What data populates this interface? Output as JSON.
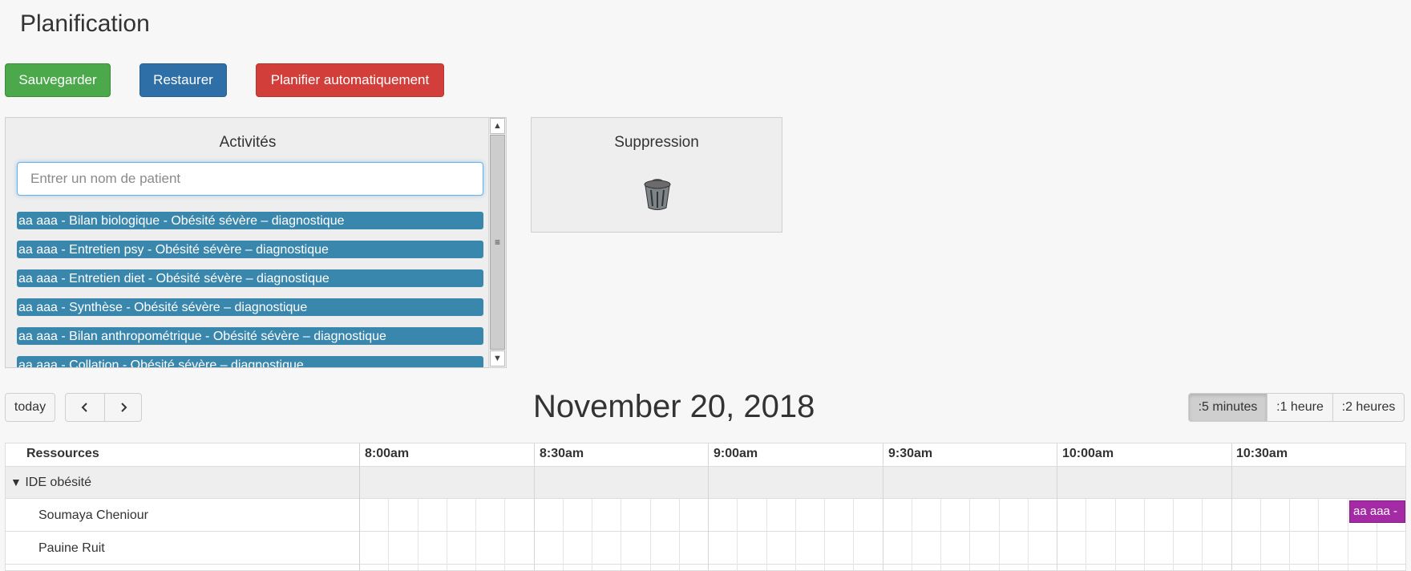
{
  "header": {
    "title": "Planification"
  },
  "toolbar": {
    "save_label": "Sauvegarder",
    "restore_label": "Restaurer",
    "auto_label": "Planifier automatiquement"
  },
  "activities": {
    "title": "Activités",
    "search_placeholder": "Entrer un nom de patient",
    "items": [
      "aa aaa - Bilan biologique - Obésité sévère – diagnostique",
      "aa aaa - Entretien psy - Obésité sévère – diagnostique",
      "aa aaa - Entretien diet - Obésité sévère – diagnostique",
      "aa aaa - Synthèse - Obésité sévère – diagnostique",
      "aa aaa - Bilan anthropométrique - Obésité sévère – diagnostique",
      "aa aaa - Collation - Obésité sévère – diagnostique"
    ],
    "item_color": "#3a87ad"
  },
  "suppression": {
    "title": "Suppression",
    "icon": "trash-icon"
  },
  "calendar": {
    "today_label": "today",
    "prev_icon": "chevron-left-icon",
    "next_icon": "chevron-right-icon",
    "title": "November 20, 2018",
    "views": [
      ":5 minutes",
      ":1 heure",
      ":2 heures"
    ],
    "active_view": ":5 minutes",
    "resources_header": "Ressources",
    "times": [
      "8:00am",
      "8:30am",
      "9:00am",
      "9:30am",
      "10:00am",
      "10:30am"
    ],
    "group": {
      "name": "IDE obésité",
      "icon": "triangle-down-icon"
    },
    "resources": [
      "Soumaya Cheniour",
      "Pauine Ruit"
    ],
    "event": {
      "label": "aa aaa -",
      "color": "#a52aa5"
    }
  }
}
